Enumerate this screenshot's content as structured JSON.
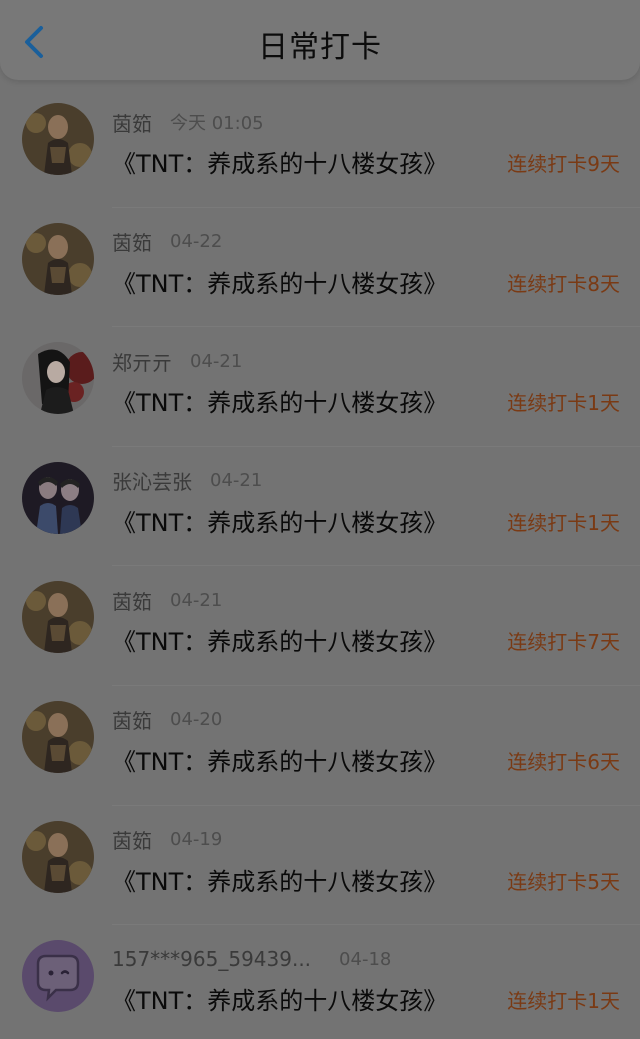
{
  "header": {
    "title": "日常打卡",
    "back_icon": "chevron-left-icon",
    "accent_color": "#1a6fb5"
  },
  "entries": [
    {
      "user": "茵筎",
      "time": "今天 01:05",
      "book": "《TNT：养成系的十八楼女孩》",
      "streak": "连续打卡9天",
      "avatar": "portrait-gold"
    },
    {
      "user": "茵筎",
      "time": "04-22",
      "book": "《TNT：养成系的十八楼女孩》",
      "streak": "连续打卡8天",
      "avatar": "portrait-gold"
    },
    {
      "user": "郑亓亓",
      "time": "04-21",
      "book": "《TNT：养成系的十八楼女孩》",
      "streak": "连续打卡1天",
      "avatar": "portrait-red"
    },
    {
      "user": "张沁芸张",
      "time": "04-21",
      "book": "《TNT：养成系的十八楼女孩》",
      "streak": "连续打卡1天",
      "avatar": "portrait-duo"
    },
    {
      "user": "茵筎",
      "time": "04-21",
      "book": "《TNT：养成系的十八楼女孩》",
      "streak": "连续打卡7天",
      "avatar": "portrait-gold"
    },
    {
      "user": "茵筎",
      "time": "04-20",
      "book": "《TNT：养成系的十八楼女孩》",
      "streak": "连续打卡6天",
      "avatar": "portrait-gold"
    },
    {
      "user": "茵筎",
      "time": "04-19",
      "book": "《TNT：养成系的十八楼女孩》",
      "streak": "连续打卡5天",
      "avatar": "portrait-gold"
    },
    {
      "user": "157***965_59439...",
      "time": "04-18",
      "book": "《TNT：养成系的十八楼女孩》",
      "streak": "连续打卡1天",
      "avatar": "default-chat-avatar"
    }
  ],
  "colors": {
    "streak": "#7a3a14",
    "title_text": "#0a0a0a",
    "meta_text": "#4d4d4d"
  }
}
